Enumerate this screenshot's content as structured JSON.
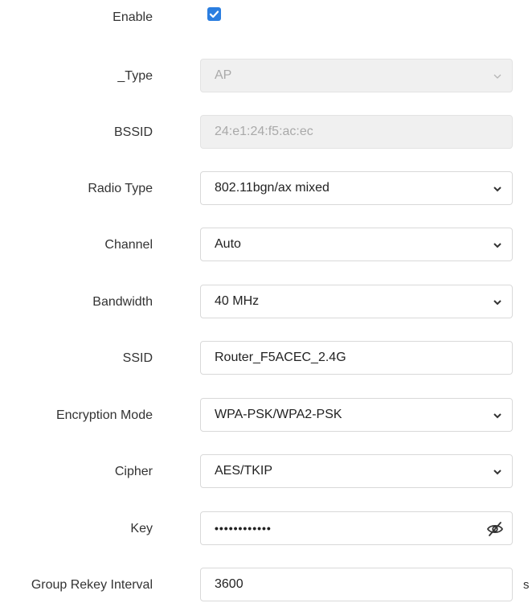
{
  "form": {
    "enable": {
      "label": "Enable",
      "checked": true
    },
    "type": {
      "label": "_Type",
      "value": "AP",
      "disabled": true
    },
    "bssid": {
      "label": "BSSID",
      "value": "24:e1:24:f5:ac:ec",
      "disabled": true
    },
    "radio_type": {
      "label": "Radio Type",
      "value": "802.11bgn/ax mixed"
    },
    "channel": {
      "label": "Channel",
      "value": "Auto"
    },
    "bandwidth": {
      "label": "Bandwidth",
      "value": "40 MHz"
    },
    "ssid": {
      "label": "SSID",
      "value": "Router_F5ACEC_2.4G"
    },
    "encryption_mode": {
      "label": "Encryption Mode",
      "value": "WPA-PSK/WPA2-PSK"
    },
    "cipher": {
      "label": "Cipher",
      "value": "AES/TKIP"
    },
    "key": {
      "label": "Key",
      "value": "••••••••••••"
    },
    "group_rekey_interval": {
      "label": "Group Rekey Interval",
      "value": "3600",
      "unit": "s"
    }
  },
  "colors": {
    "accent": "#2b7ee0",
    "disabled_bg": "#f0f0f0",
    "border": "#d9d9d9"
  },
  "icons": {
    "checkbox": "check-icon",
    "select": "chevron-down-icon",
    "password": "eye-off-icon"
  }
}
